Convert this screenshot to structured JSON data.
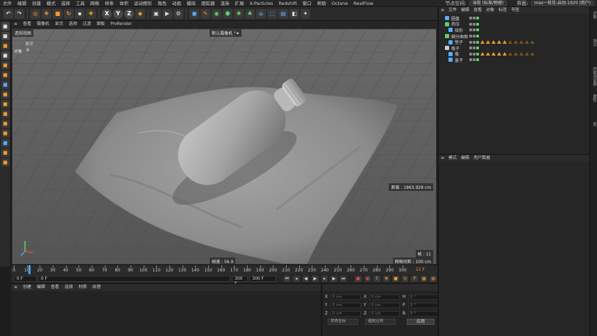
{
  "menubar": {
    "items": [
      "文件",
      "编辑",
      "创建",
      "模式",
      "选择",
      "工具",
      "网格",
      "样条",
      "体积",
      "运动图形",
      "角色",
      "动画",
      "模拟",
      "跟踪器",
      "渲染",
      "扩展",
      "X-Particles",
      "Redshift",
      "窗口",
      "帮助",
      "Octane",
      "RealFlow"
    ],
    "node_space_label": "节点空间:",
    "node_space_value": "当前 (标准/物理)",
    "layout_label": "界面:",
    "layout_value": "max一枝花-启动-1920 (用户)"
  },
  "toolbar": {
    "axis_labels": [
      "X",
      "Y",
      "Z"
    ]
  },
  "left_tools": [
    "gray",
    "gray",
    "orange",
    "gray",
    "orange",
    "orange",
    "blue",
    "orange",
    "orange",
    "orange",
    "orange",
    "orange",
    "blue",
    "orange",
    "orange"
  ],
  "viewport": {
    "menu": [
      "查看",
      "摄像机",
      "显示",
      "选项",
      "过滤",
      "面板",
      "ProRender"
    ],
    "view_name": "透视视图",
    "camera_label": "默认摄像机 °✦",
    "stats_total_label": "总计",
    "stats_objects_label": "对象",
    "stats_objects_value": "8",
    "distance": "距离 : 1863.928 cm",
    "frame_rate": "帧速 : 56.9",
    "frame": "帧 : 11",
    "grid_spacing": "网格间距 : 100 cm"
  },
  "timeline": {
    "ticks": [
      0,
      10,
      20,
      30,
      40,
      50,
      60,
      70,
      80,
      90,
      100,
      110,
      120,
      130,
      140,
      150,
      160,
      170,
      180,
      190,
      200,
      210,
      220,
      230,
      240,
      250,
      260,
      270,
      280,
      290,
      300
    ],
    "current_frame": 11,
    "current_frame_label": "11 F",
    "max": 300
  },
  "transport": {
    "start": "0 F",
    "current": "0 F",
    "end": "300 F",
    "end2": "300 F"
  },
  "material_panel": {
    "menu": [
      "创建",
      "编辑",
      "查看",
      "选择",
      "材质",
      "纹理"
    ]
  },
  "coordinates": {
    "rows": [
      {
        "a": "X",
        "av": "0 cm",
        "b": "X",
        "bv": "0 cm",
        "c": "H",
        "cv": "0 °"
      },
      {
        "a": "Y",
        "av": "0 cm",
        "b": "Y",
        "bv": "0 cm",
        "c": "P",
        "cv": "0 °"
      },
      {
        "a": "Z",
        "av": "0 cm",
        "b": "Z",
        "bv": "0 cm",
        "c": "B",
        "cv": "0 °"
      }
    ],
    "mode1": "世界坐标",
    "mode2": "缩放比例",
    "apply": "应用"
  },
  "object_manager": {
    "menu": [
      "文件",
      "编辑",
      "查看",
      "对象",
      "标签",
      "书签"
    ],
    "objects": [
      {
        "name": "圆盘",
        "icon_color": "#5aaeff",
        "indent": 1,
        "tags": 0
      },
      {
        "name": "挤压",
        "icon_color": "#5fd36b",
        "indent": 1,
        "tags": 0
      },
      {
        "name": "矩形",
        "icon_color": "#5aaeff",
        "indent": 2,
        "tags": 0
      },
      {
        "name": "细分曲面",
        "icon_color": "#5fd36b",
        "indent": 1,
        "tags": 0
      },
      {
        "name": "垫子",
        "icon_color": "#5aaeff",
        "indent": 2,
        "tags": 10
      },
      {
        "name": "瓶子",
        "icon_color": "#cfcfcf",
        "indent": 1,
        "tags": 0
      },
      {
        "name": "瓶",
        "icon_color": "#5aaeff",
        "indent": 2,
        "tags": 10
      },
      {
        "name": "盖子",
        "icon_color": "#5aaeff",
        "indent": 2,
        "tags": 0
      }
    ]
  },
  "attribute_manager": {
    "menu": [
      "模式",
      "编辑",
      "用户数据"
    ]
  },
  "side_tabs": [
    "对象",
    "场次",
    "内容浏览器",
    "属性",
    "层"
  ]
}
